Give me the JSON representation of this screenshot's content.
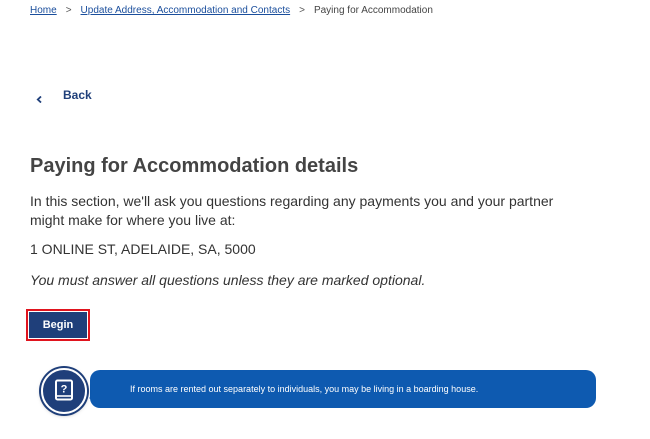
{
  "breadcrumb": {
    "home": "Home",
    "parent": "Update Address, Accommodation and Contacts",
    "current": "Paying for Accommodation",
    "separator": ">"
  },
  "back_label": "Back",
  "page": {
    "title": "Paying for Accommodation details",
    "intro": "In this section, we'll ask you questions regarding any payments you and your partner might make for where you live at:",
    "address": "1 ONLINE ST, ADELAIDE, SA, 5000",
    "note": "You must answer all questions unless they are marked optional."
  },
  "begin_label": "Begin",
  "tip": {
    "icon": "help-book-icon",
    "text": "If rooms are rented out separately to individuals, you may be living in a boarding house."
  },
  "colors": {
    "link": "#1a4e9c",
    "primary": "#1f3f7a",
    "tip_background": "#0e5ab0",
    "highlight": "#e0141e"
  }
}
